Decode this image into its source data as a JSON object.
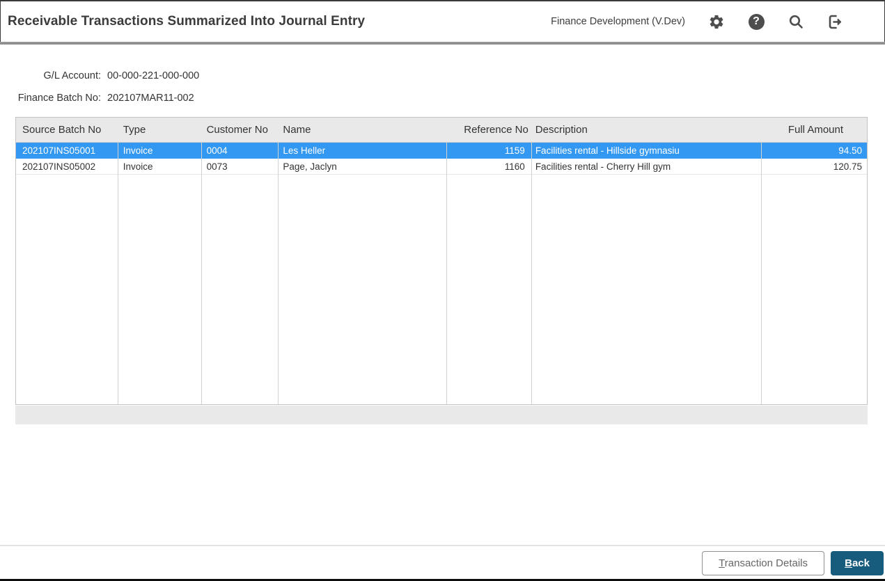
{
  "window": {
    "title": "Receivable Transactions Summarized Into Journal Entry",
    "environment": "Finance Development (V.Dev)"
  },
  "header_icons": [
    "gear-icon",
    "help-icon",
    "search-icon",
    "sign-out-icon"
  ],
  "fields": [
    {
      "label": "G/L Account:",
      "value": "00-000-221-000-000"
    },
    {
      "label": "Finance Batch No:",
      "value": "202107MAR11-002"
    }
  ],
  "table": {
    "columns": [
      "Source Batch No",
      "Type",
      "Customer No",
      "Name",
      "Reference No",
      "Description",
      "Full Amount"
    ],
    "rows": [
      [
        "202107INS05001",
        "Invoice",
        "0004",
        "Les Heller",
        "1159",
        "Facilities rental - Hillside gymnasiu",
        "94.50"
      ],
      [
        "202107INS05002",
        "Invoice",
        "0073",
        "Page, Jaclyn",
        "1160",
        "Facilities rental - Cherry Hill gym",
        "120.75"
      ]
    ],
    "selected_row_index": 0
  },
  "footer": {
    "transaction_details_label": "Transaction Details",
    "back_label": "Back"
  },
  "colors": {
    "selected_row": "#3398f2",
    "primary_button": "#175c7d",
    "icon": "#4d4d4d"
  }
}
